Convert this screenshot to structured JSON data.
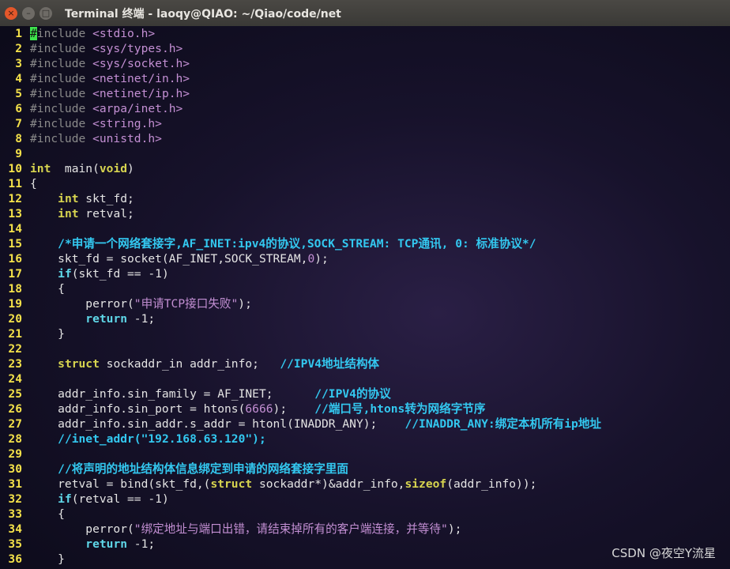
{
  "window": {
    "title": "Terminal 终端 - laoqy@QIAO: ~/Qiao/code/net",
    "close_glyph": "×",
    "min_glyph": "–",
    "max_glyph": "□"
  },
  "colors": {
    "line_number": "#f4e14a",
    "keyword": "#5fd7e8",
    "type": "#d7d44f",
    "comment": "#33c8f0",
    "string": "#c38fd3",
    "preprocessor": "#8a8a8a",
    "cursor": "#3ee44c"
  },
  "watermark": "CSDN @夜空Y流星",
  "lines": [
    [
      [
        "cur",
        "#"
      ],
      [
        "pp",
        "include "
      ],
      [
        "hdr",
        "<stdio.h>"
      ]
    ],
    [
      [
        "pp",
        "#include "
      ],
      [
        "hdr",
        "<sys/types.h>"
      ]
    ],
    [
      [
        "pp",
        "#include "
      ],
      [
        "hdr",
        "<sys/socket.h>"
      ]
    ],
    [
      [
        "pp",
        "#include "
      ],
      [
        "hdr",
        "<netinet/in.h>"
      ]
    ],
    [
      [
        "pp",
        "#include "
      ],
      [
        "hdr",
        "<netinet/ip.h>"
      ]
    ],
    [
      [
        "pp",
        "#include "
      ],
      [
        "hdr",
        "<arpa/inet.h>"
      ]
    ],
    [
      [
        "pp",
        "#include "
      ],
      [
        "hdr",
        "<string.h>"
      ]
    ],
    [
      [
        "pp",
        "#include "
      ],
      [
        "hdr",
        "<unistd.h>"
      ]
    ],
    [],
    [
      [
        "ty",
        "int"
      ],
      [
        "",
        "  main("
      ],
      [
        "ty",
        "void"
      ],
      [
        "",
        ")"
      ]
    ],
    [
      [
        "",
        "{"
      ]
    ],
    [
      [
        "",
        "    "
      ],
      [
        "ty",
        "int"
      ],
      [
        "",
        " skt_fd;"
      ]
    ],
    [
      [
        "",
        "    "
      ],
      [
        "ty",
        "int"
      ],
      [
        "",
        " retval;"
      ]
    ],
    [],
    [
      [
        "",
        "    "
      ],
      [
        "cm",
        "/*申请一个网络套接字,AF_INET:ipv4的协议,SOCK_STREAM: TCP通讯, 0: 标准协议*/"
      ]
    ],
    [
      [
        "",
        "    skt_fd = socket(AF_INET,SOCK_STREAM,"
      ],
      [
        "num",
        "0"
      ],
      [
        "",
        ");"
      ]
    ],
    [
      [
        "",
        "    "
      ],
      [
        "kw",
        "if"
      ],
      [
        "",
        "(skt_fd == -1)"
      ]
    ],
    [
      [
        "",
        "    {"
      ]
    ],
    [
      [
        "",
        "        perror("
      ],
      [
        "str",
        "\"申请TCP接口失败\""
      ],
      [
        "",
        ");"
      ]
    ],
    [
      [
        "",
        "        "
      ],
      [
        "kw",
        "return"
      ],
      [
        "",
        " -1;"
      ]
    ],
    [
      [
        "",
        "    }"
      ]
    ],
    [],
    [
      [
        "",
        "    "
      ],
      [
        "ty",
        "struct"
      ],
      [
        "",
        " sockaddr_in addr_info;   "
      ],
      [
        "cm",
        "//IPV4地址结构体"
      ]
    ],
    [],
    [
      [
        "",
        "    addr_info.sin_family = AF_INET;      "
      ],
      [
        "cm",
        "//IPV4的协议"
      ]
    ],
    [
      [
        "",
        "    addr_info.sin_port = htons("
      ],
      [
        "num",
        "6666"
      ],
      [
        "",
        ");    "
      ],
      [
        "cm",
        "//端口号,htons转为网络字节序"
      ]
    ],
    [
      [
        "",
        "    addr_info.sin_addr.s_addr = htonl(INADDR_ANY);    "
      ],
      [
        "cm",
        "//INADDR_ANY:绑定本机所有ip地址"
      ]
    ],
    [
      [
        "",
        "    "
      ],
      [
        "cm",
        "//inet_addr(\"192.168.63.120\");"
      ]
    ],
    [],
    [
      [
        "",
        "    "
      ],
      [
        "cm",
        "//将声明的地址结构体信息绑定到申请的网络套接字里面"
      ]
    ],
    [
      [
        "",
        "    retval = bind(skt_fd,("
      ],
      [
        "ty",
        "struct"
      ],
      [
        "",
        " sockaddr*)&addr_info,"
      ],
      [
        "ty",
        "sizeof"
      ],
      [
        "",
        "(addr_info));"
      ]
    ],
    [
      [
        "",
        "    "
      ],
      [
        "kw",
        "if"
      ],
      [
        "",
        "(retval == -1)"
      ]
    ],
    [
      [
        "",
        "    {"
      ]
    ],
    [
      [
        "",
        "        perror("
      ],
      [
        "str",
        "\"绑定地址与端口出错，请结束掉所有的客户端连接，并等待\""
      ],
      [
        "",
        ");"
      ]
    ],
    [
      [
        "",
        "        "
      ],
      [
        "kw",
        "return"
      ],
      [
        "",
        " -1;"
      ]
    ],
    [
      [
        "",
        "    }"
      ]
    ]
  ]
}
